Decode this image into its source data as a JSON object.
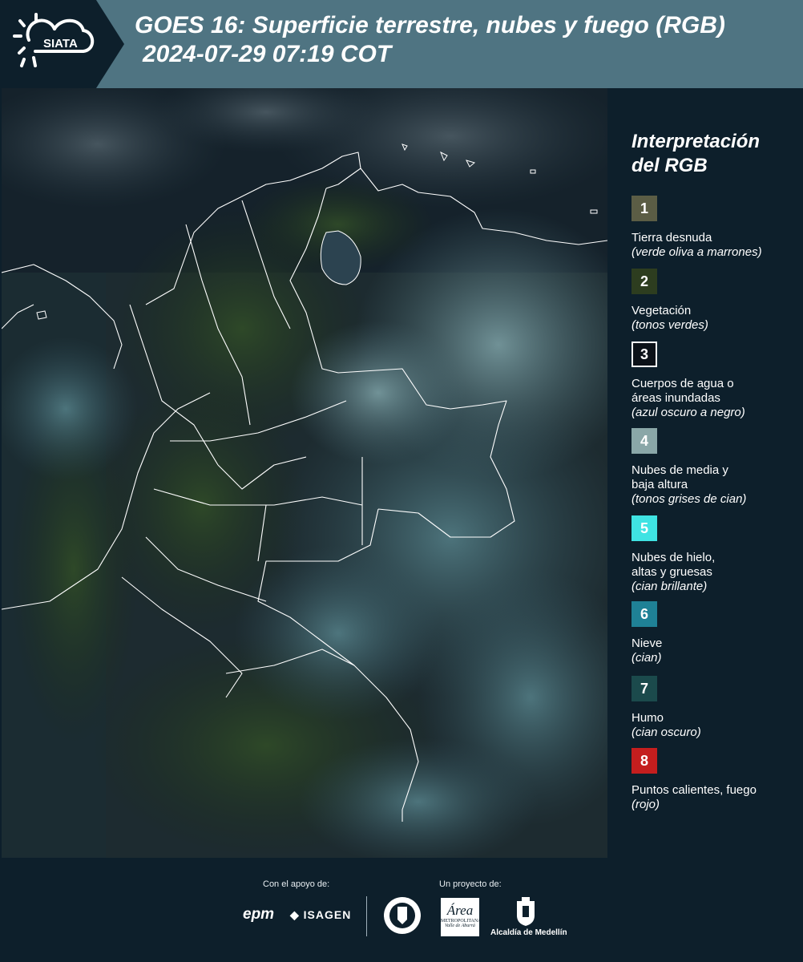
{
  "header": {
    "logo_text": "SIATA",
    "title_line1": "GOES 16: Superficie terrestre, nubes y fuego (RGB)",
    "title_line2": "2024-07-29 07:19 COT"
  },
  "legend": {
    "title_line1": "Interpretación",
    "title_line2": "del RGB",
    "items": [
      {
        "number": "1",
        "color": "#5b5d45",
        "lines": [
          "Tierra desnuda"
        ],
        "note": "(verde oliva a marrones)"
      },
      {
        "number": "2",
        "color": "#2d3d1f",
        "lines": [
          "Vegetación"
        ],
        "note": "(tonos verdes)"
      },
      {
        "number": "3",
        "color": "#0b1118",
        "lines": [
          "Cuerpos de agua o",
          "áreas inundadas"
        ],
        "note": "(azul oscuro a negro)"
      },
      {
        "number": "4",
        "color": "#8aa7a8",
        "lines": [
          "Nubes de media y",
          "baja altura"
        ],
        "note": "(tonos grises de cian)"
      },
      {
        "number": "5",
        "color": "#3fe3e3",
        "lines": [
          "Nubes de hielo,",
          "altas y gruesas"
        ],
        "note": "(cian brillante)"
      },
      {
        "number": "6",
        "color": "#1f8196",
        "lines": [
          "Nieve"
        ],
        "note": "(cian)"
      },
      {
        "number": "7",
        "color": "#1b4a4c",
        "lines": [
          "Humo"
        ],
        "note": "(cian oscuro)"
      },
      {
        "number": "8",
        "color": "#c41e1e",
        "lines": [
          "Puntos calientes, fuego"
        ],
        "note": "(rojo)"
      }
    ]
  },
  "footer": {
    "support_label": "Con el apoyo de:",
    "project_label": "Un proyecto de:",
    "sponsor_epm": "epm",
    "sponsor_isagen": "ISAGEN",
    "area_logo_text": "Área",
    "area_logo_sub1": "METROPOLITANA",
    "area_logo_sub2": "Valle de Aburrá",
    "alcaldia": "Alcaldía de Medellín"
  }
}
